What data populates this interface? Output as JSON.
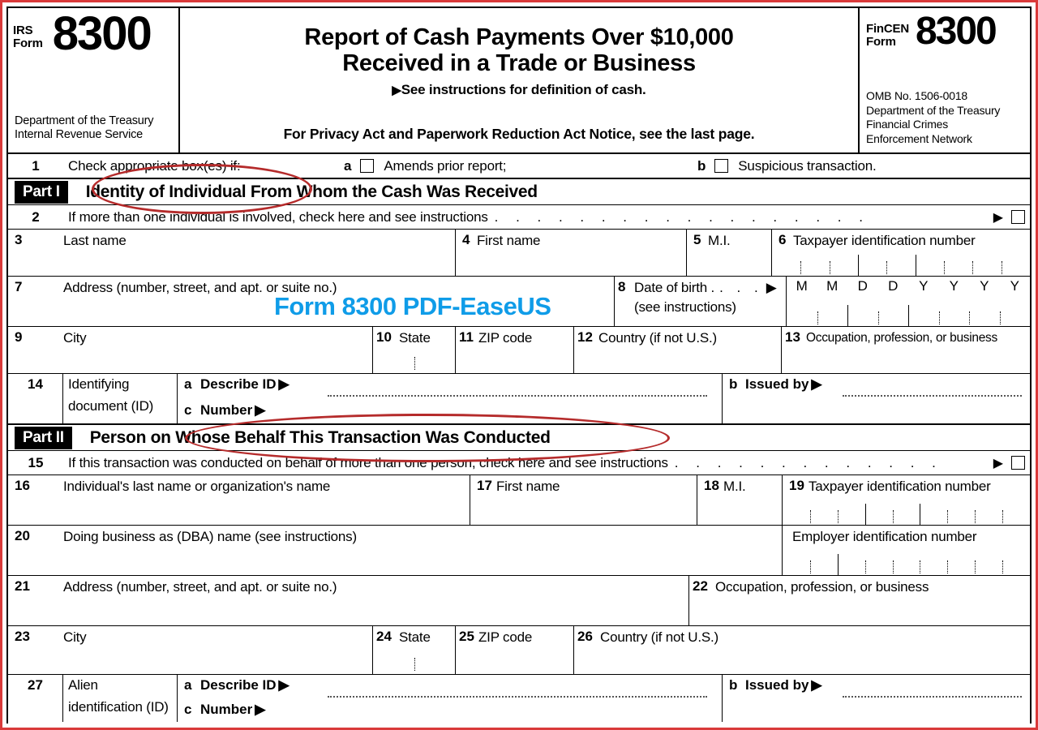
{
  "header": {
    "irs_label_line1": "IRS",
    "irs_label_line2": "Form",
    "irs_form_number": "8300",
    "agency_line1": "Department of the Treasury",
    "agency_line2": "Internal Revenue Service",
    "title_line1": "Report of Cash Payments Over $10,000",
    "title_line2": "Received in a Trade or Business",
    "subtitle": "See instructions for definition of cash.",
    "privacy_notice": "For Privacy Act and Paperwork Reduction Act Notice, see the last page.",
    "fincen_label_line1": "FinCEN",
    "fincen_label_line2": "Form",
    "fincen_form_number": "8300",
    "omb_line1": "OMB No. 1506-0018",
    "omb_line2": "Department of the Treasury",
    "omb_line3": "Financial Crimes",
    "omb_line4": "Enforcement Network"
  },
  "line1": {
    "number": "1",
    "label": "Check appropriate box(es) if:",
    "option_a_letter": "a",
    "option_a_label": "Amends prior report;",
    "option_b_letter": "b",
    "option_b_label": "Suspicious transaction."
  },
  "part1": {
    "tag": "Part I",
    "title": "Identity of Individual From Whom the Cash Was Received"
  },
  "line2": {
    "number": "2",
    "label": "If more than one individual is involved, check here and see instructions",
    "leader": ". . . . . . . . . . . . . . . . . ."
  },
  "row_3_6": {
    "f3_num": "3",
    "f3_label": "Last name",
    "f4_num": "4",
    "f4_label": "First name",
    "f5_num": "5",
    "f5_label": "M.I.",
    "f6_num": "6",
    "f6_label": "Taxpayer identification number"
  },
  "row_7_8": {
    "f7_num": "7",
    "f7_label": "Address (number, street, and apt. or suite no.)",
    "f8_num": "8",
    "f8_label": "Date of birth .",
    "f8_leader": ". . .",
    "f8_sub": "(see instructions)",
    "dob_headers": [
      "M",
      "M",
      "D",
      "D",
      "Y",
      "Y",
      "Y",
      "Y"
    ]
  },
  "row_9_13": {
    "f9_num": "9",
    "f9_label": "City",
    "f10_num": "10",
    "f10_label": "State",
    "f11_num": "11",
    "f11_label": "ZIP code",
    "f12_num": "12",
    "f12_label": "Country (if not U.S.)",
    "f13_num": "13",
    "f13_label": "Occupation, profession, or business"
  },
  "row_14": {
    "num": "14",
    "label_line1": "Identifying",
    "label_line2": "document (ID)",
    "a_letter": "a",
    "a_label": "Describe ID",
    "b_letter": "b",
    "b_label": "Issued by",
    "c_letter": "c",
    "c_label": "Number"
  },
  "part2": {
    "tag": "Part II",
    "title": "Person on Whose Behalf This Transaction Was Conducted"
  },
  "line15": {
    "number": "15",
    "label": "If this transaction was conducted on behalf of more than one person, check here and see instructions",
    "leader": ". . . . . . . . . . . . ."
  },
  "row_16_19": {
    "f16_num": "16",
    "f16_label": "Individual's last name or organization's name",
    "f17_num": "17",
    "f17_label": "First name",
    "f18_num": "18",
    "f18_label": "M.I.",
    "f19_num": "19",
    "f19_label": "Taxpayer identification number"
  },
  "row_20": {
    "num": "20",
    "label": "Doing business as (DBA) name (see instructions)",
    "ein_label": "Employer identification number"
  },
  "row_21_22": {
    "f21_num": "21",
    "f21_label": "Address (number, street, and apt. or suite no.)",
    "f22_num": "22",
    "f22_label": "Occupation, profession, or business"
  },
  "row_23_26": {
    "f23_num": "23",
    "f23_label": "City",
    "f24_num": "24",
    "f24_label": "State",
    "f25_num": "25",
    "f25_label": "ZIP code",
    "f26_num": "26",
    "f26_label": "Country (if not U.S.)"
  },
  "row_27": {
    "num": "27",
    "label_line1": "Alien",
    "label_line2": "identification (ID)",
    "a_letter": "a",
    "a_label": "Describe ID",
    "b_letter": "b",
    "b_label": "Issued by",
    "c_letter": "c",
    "c_label": "Number"
  },
  "watermark": {
    "text": "Form 8300 PDF-EaseUS",
    "color": "#0f9ce8"
  },
  "annotations": {
    "color": "#b52b2b",
    "frame_color": "#d93a3a",
    "ellipse_1_target": "Identity of Individual From Whom the Cash Was Received",
    "ellipse_2_target": "Person on Whose Behalf This Transaction Was Conducted"
  },
  "glyphs": {
    "triangle_right": "▶"
  }
}
